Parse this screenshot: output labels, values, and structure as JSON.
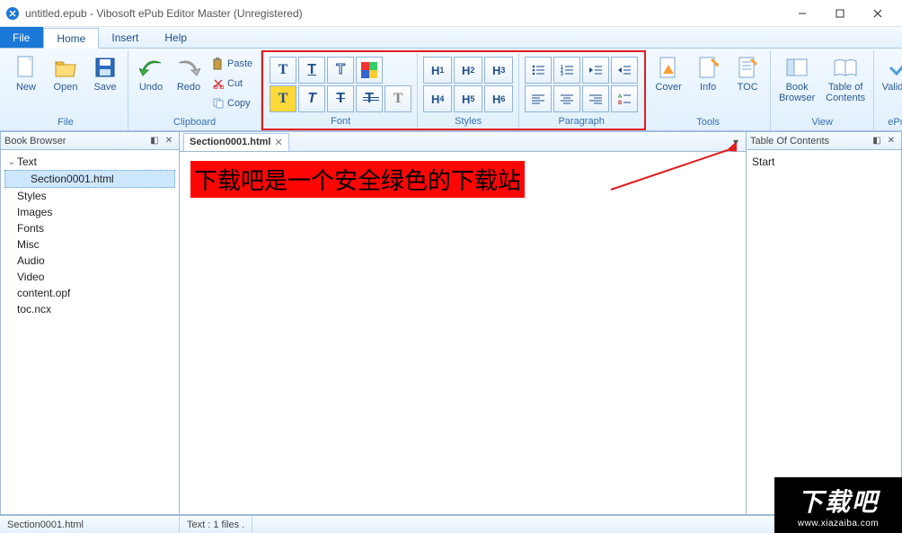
{
  "window": {
    "title": "untitled.epub - Vibosoft ePub Editor Master (Unregistered)"
  },
  "menubar": {
    "file": "File",
    "home": "Home",
    "insert": "Insert",
    "help": "Help"
  },
  "ribbon": {
    "file_group": {
      "label": "File",
      "new": "New",
      "open": "Open",
      "save": "Save"
    },
    "clipboard_group": {
      "label": "Clipboard",
      "undo": "Undo",
      "redo": "Redo",
      "paste": "Paste",
      "cut": "Cut",
      "copy": "Copy"
    },
    "font_group": {
      "label": "Font"
    },
    "styles_group": {
      "label": "Styles",
      "h1": "H1",
      "h2": "H2",
      "h3": "H3",
      "h4": "H4",
      "h5": "H5",
      "h6": "H6"
    },
    "paragraph_group": {
      "label": "Paragraph"
    },
    "tools_group": {
      "label": "Tools",
      "cover": "Cover",
      "info": "Info",
      "toc": "TOC"
    },
    "view_group": {
      "label": "View",
      "book_browser": "Book\nBrowser",
      "toc": "Table of\nContents"
    },
    "epub_group": {
      "label": "ePub",
      "validate": "Validate"
    }
  },
  "book_browser": {
    "title": "Book Browser",
    "root": "Text",
    "selected": "Section0001.html",
    "items": [
      "Styles",
      "Images",
      "Fonts",
      "Misc",
      "Audio",
      "Video",
      "content.opf",
      "toc.ncx"
    ]
  },
  "tabs": {
    "active": "Section0001.html"
  },
  "editor": {
    "banner_text": "下载吧是一个安全绿色的下载站"
  },
  "toc_panel": {
    "title": "Table Of Contents",
    "root": "Start"
  },
  "status": {
    "left": "Section0001.html",
    "right": "Text : 1 files ."
  },
  "watermark": {
    "text": "下载吧",
    "url": "www.xiazaiba.com"
  }
}
